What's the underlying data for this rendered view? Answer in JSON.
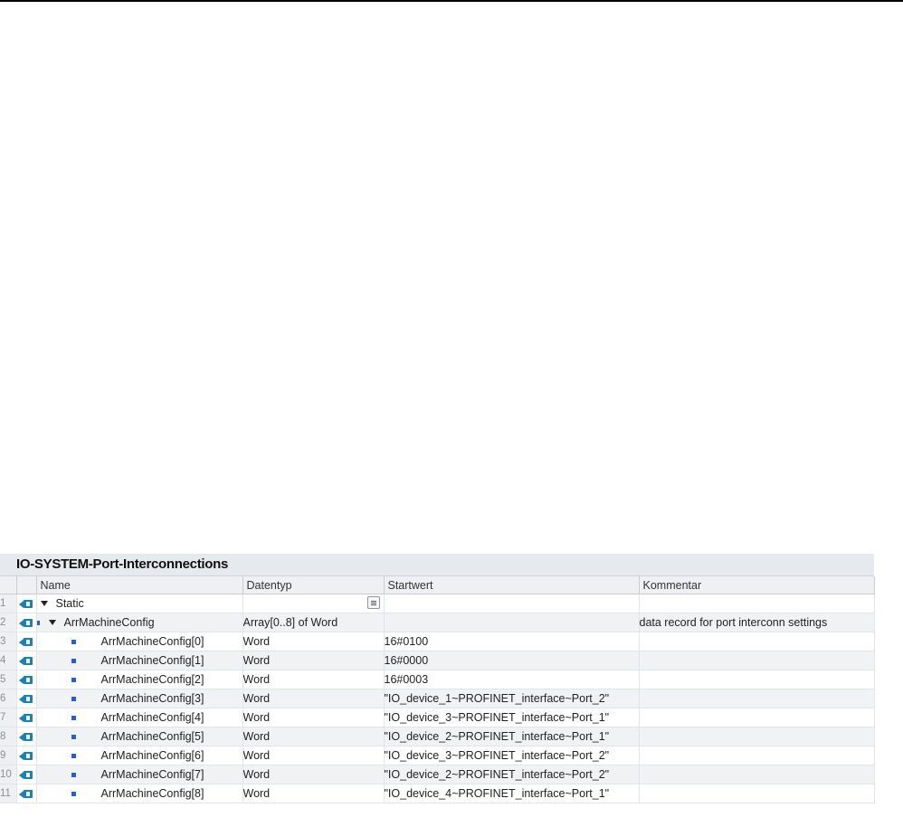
{
  "panel": {
    "title": "IO-SYSTEM-Port-Interconnections",
    "columns": {
      "name": "Name",
      "datatype": "Datentyp",
      "startvalue": "Startwert",
      "comment": "Kommentar"
    }
  },
  "rows": [
    {
      "num": "1",
      "name": "Static",
      "datatype": "",
      "startvalue": "",
      "comment": ""
    },
    {
      "num": "2",
      "name": "ArrMachineConfig",
      "datatype": "Array[0..8] of Word",
      "startvalue": "",
      "comment": "data record for port interconn settings"
    },
    {
      "num": "3",
      "name": "ArrMachineConfig[0]",
      "datatype": "Word",
      "startvalue": "16#0100",
      "comment": ""
    },
    {
      "num": "4",
      "name": "ArrMachineConfig[1]",
      "datatype": "Word",
      "startvalue": "16#0000",
      "comment": ""
    },
    {
      "num": "5",
      "name": "ArrMachineConfig[2]",
      "datatype": "Word",
      "startvalue": "16#0003",
      "comment": ""
    },
    {
      "num": "6",
      "name": "ArrMachineConfig[3]",
      "datatype": "Word",
      "startvalue": "\"IO_device_1~PROFINET_interface~Port_2\"",
      "comment": ""
    },
    {
      "num": "7",
      "name": "ArrMachineConfig[4]",
      "datatype": "Word",
      "startvalue": "\"IO_device_3~PROFINET_interface~Port_1\"",
      "comment": ""
    },
    {
      "num": "8",
      "name": "ArrMachineConfig[5]",
      "datatype": "Word",
      "startvalue": "\"IO_device_2~PROFINET_interface~Port_1\"",
      "comment": ""
    },
    {
      "num": "9",
      "name": "ArrMachineConfig[6]",
      "datatype": "Word",
      "startvalue": "\"IO_device_3~PROFINET_interface~Port_2\"",
      "comment": ""
    },
    {
      "num": "10",
      "name": "ArrMachineConfig[7]",
      "datatype": "Word",
      "startvalue": "\"IO_device_2~PROFINET_interface~Port_2\"",
      "comment": ""
    },
    {
      "num": "11",
      "name": "ArrMachineConfig[8]",
      "datatype": "Word",
      "startvalue": "\"IO_device_4~PROFINET_interface~Port_1\"",
      "comment": ""
    }
  ],
  "icons": {
    "row_icon": "interface-io-icon",
    "expand": "triangle-down-icon",
    "member": "blue-square-bullet-icon",
    "datatype_list": "datatype-list-button-icon"
  },
  "colors": {
    "title_bar": "#e6e9ee",
    "io_icon": "#1f7fb0",
    "bullet": "#2b5fc7"
  }
}
